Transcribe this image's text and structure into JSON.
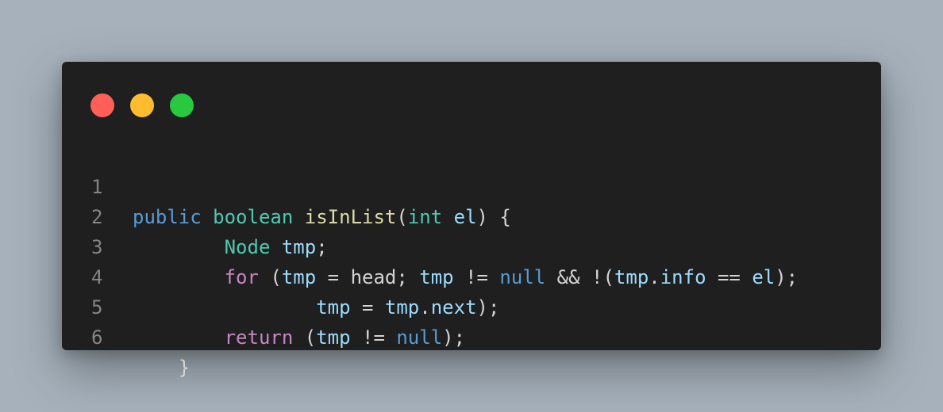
{
  "window": {
    "dots": [
      {
        "name": "close-dot",
        "color": "#ff5f57"
      },
      {
        "name": "minimize-dot",
        "color": "#febc2e"
      },
      {
        "name": "maximize-dot",
        "color": "#28c840"
      }
    ]
  },
  "code": {
    "colors": {
      "plain": "#d4d4d4",
      "kw": "#569cd6",
      "type": "#4ec9b0",
      "fn": "#dcdcaa",
      "var": "#9cdcfe",
      "ctrl": "#c586c0"
    },
    "lines": [
      {
        "number": "1",
        "tokens": [
          {
            "t": "public",
            "c": "kw"
          },
          {
            "t": " ",
            "c": "plain"
          },
          {
            "t": "boolean",
            "c": "type"
          },
          {
            "t": " ",
            "c": "plain"
          },
          {
            "t": "isInList",
            "c": "fn"
          },
          {
            "t": "(",
            "c": "plain"
          },
          {
            "t": "int",
            "c": "type"
          },
          {
            "t": " ",
            "c": "plain"
          },
          {
            "t": "el",
            "c": "var"
          },
          {
            "t": ") {",
            "c": "plain"
          }
        ]
      },
      {
        "number": "2",
        "tokens": [
          {
            "t": "        ",
            "c": "plain"
          },
          {
            "t": "Node",
            "c": "type"
          },
          {
            "t": " ",
            "c": "plain"
          },
          {
            "t": "tmp",
            "c": "var"
          },
          {
            "t": ";",
            "c": "plain"
          }
        ]
      },
      {
        "number": "3",
        "tokens": [
          {
            "t": "        ",
            "c": "plain"
          },
          {
            "t": "for",
            "c": "ctrl"
          },
          {
            "t": " (",
            "c": "plain"
          },
          {
            "t": "tmp",
            "c": "var"
          },
          {
            "t": " = head; ",
            "c": "plain"
          },
          {
            "t": "tmp",
            "c": "var"
          },
          {
            "t": " != ",
            "c": "plain"
          },
          {
            "t": "null",
            "c": "kw"
          },
          {
            "t": " && !(",
            "c": "plain"
          },
          {
            "t": "tmp",
            "c": "var"
          },
          {
            "t": ".",
            "c": "plain"
          },
          {
            "t": "info",
            "c": "var"
          },
          {
            "t": " == ",
            "c": "plain"
          },
          {
            "t": "el",
            "c": "var"
          },
          {
            "t": ");",
            "c": "plain"
          }
        ]
      },
      {
        "number": "4",
        "tokens": [
          {
            "t": "                ",
            "c": "plain"
          },
          {
            "t": "tmp",
            "c": "var"
          },
          {
            "t": " = ",
            "c": "plain"
          },
          {
            "t": "tmp",
            "c": "var"
          },
          {
            "t": ".",
            "c": "plain"
          },
          {
            "t": "next",
            "c": "var"
          },
          {
            "t": ");",
            "c": "plain"
          }
        ]
      },
      {
        "number": "5",
        "tokens": [
          {
            "t": "        ",
            "c": "plain"
          },
          {
            "t": "return",
            "c": "ctrl"
          },
          {
            "t": " (",
            "c": "plain"
          },
          {
            "t": "tmp",
            "c": "var"
          },
          {
            "t": " != ",
            "c": "plain"
          },
          {
            "t": "null",
            "c": "kw"
          },
          {
            "t": ");",
            "c": "plain"
          }
        ]
      },
      {
        "number": "6",
        "tokens": [
          {
            "t": "    }",
            "c": "plain"
          }
        ]
      }
    ]
  }
}
